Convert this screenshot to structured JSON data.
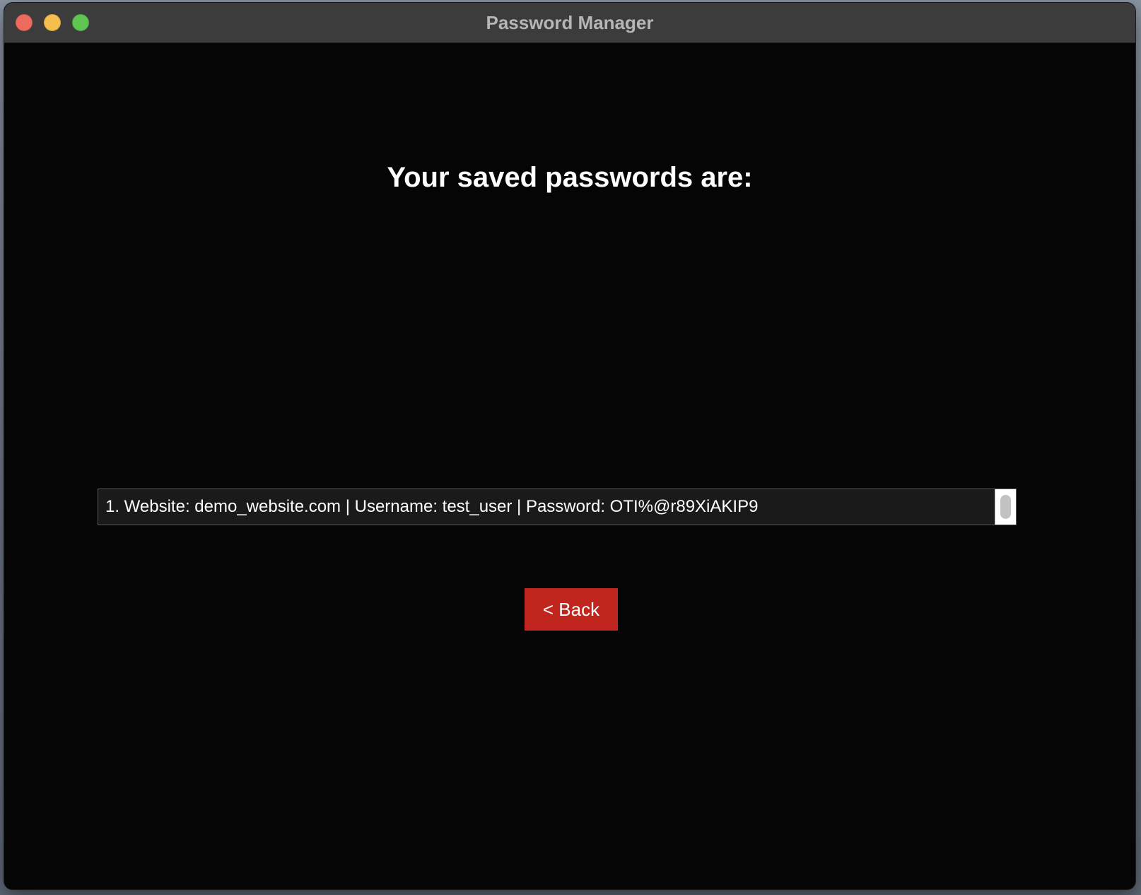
{
  "window": {
    "title": "Password Manager"
  },
  "main": {
    "heading": "Your saved passwords are:",
    "entries": [
      "1. Website: demo_website.com | Username: test_user | Password: OTI%@r89XiAKIP9"
    ],
    "back_label": "< Back"
  },
  "colors": {
    "background": "#050505",
    "back_button": "#c0261e",
    "titlebar": "#3c3c3c"
  }
}
